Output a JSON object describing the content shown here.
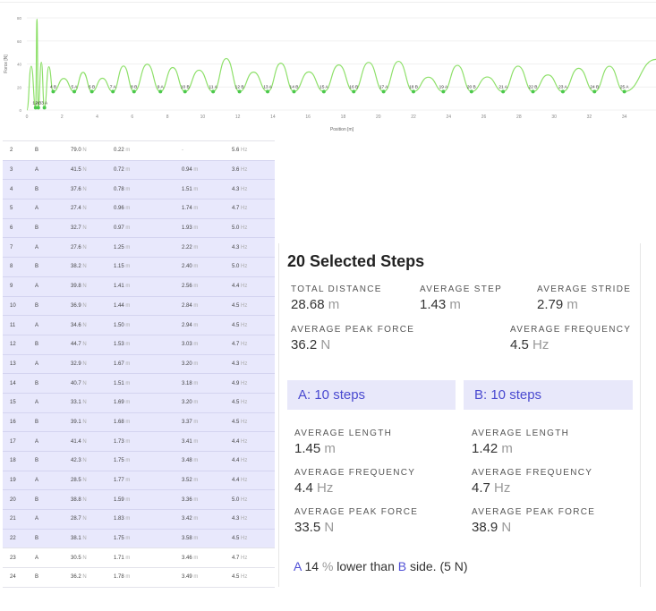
{
  "chart": {
    "y_axis_label": "Force [N]",
    "x_axis_label": "Position [m]",
    "y_ticks": [
      "80",
      "60",
      "40",
      "20",
      "0"
    ],
    "x_ticks": [
      "0",
      "2",
      "4",
      "6",
      "8",
      "10",
      "12",
      "14",
      "16",
      "18",
      "20",
      "22",
      "24",
      "26",
      "28",
      "30",
      "32",
      "34"
    ],
    "line_color": "#8ee06a",
    "marker_color": "#4cc94c",
    "step_markers": [
      {
        "label": "1 A",
        "x": 0.5
      },
      {
        "label": "2 B",
        "x": 0.65
      },
      {
        "label": "3 A",
        "x": 1.0
      },
      {
        "label": "4 B",
        "x": 1.5
      },
      {
        "label": "5 A",
        "x": 2.7
      },
      {
        "label": "6 B",
        "x": 3.7
      },
      {
        "label": "7 A",
        "x": 4.9
      },
      {
        "label": "8 B",
        "x": 6.1
      },
      {
        "label": "9 A",
        "x": 7.6
      },
      {
        "label": "10 B",
        "x": 9.0
      },
      {
        "label": "11 A",
        "x": 10.6
      },
      {
        "label": "12 B",
        "x": 12.1
      },
      {
        "label": "13 A",
        "x": 13.7
      },
      {
        "label": "14 B",
        "x": 15.2
      },
      {
        "label": "15 A",
        "x": 16.9
      },
      {
        "label": "16 B",
        "x": 18.6
      },
      {
        "label": "17 A",
        "x": 20.3
      },
      {
        "label": "18 B",
        "x": 22.0
      },
      {
        "label": "19 A",
        "x": 23.7
      },
      {
        "label": "20 B",
        "x": 25.3
      },
      {
        "label": "21 A",
        "x": 27.1
      },
      {
        "label": "22 B",
        "x": 28.8
      },
      {
        "label": "23 A",
        "x": 30.5
      },
      {
        "label": "24 B",
        "x": 32.3
      },
      {
        "label": "25 A",
        "x": 34.0
      }
    ]
  },
  "table": {
    "rows": [
      {
        "n": "2",
        "side": "B",
        "force": "79.0",
        "force_unit": "N",
        "length": "0.22",
        "length_unit": "m",
        "stride": "-",
        "stride_unit": "",
        "freq": "5.6",
        "freq_unit": "Hz",
        "selected": false
      },
      {
        "n": "3",
        "side": "A",
        "force": "41.5",
        "force_unit": "N",
        "length": "0.72",
        "length_unit": "m",
        "stride": "0.94",
        "stride_unit": "m",
        "freq": "3.6",
        "freq_unit": "Hz",
        "selected": true
      },
      {
        "n": "4",
        "side": "B",
        "force": "37.6",
        "force_unit": "N",
        "length": "0.78",
        "length_unit": "m",
        "stride": "1.51",
        "stride_unit": "m",
        "freq": "4.3",
        "freq_unit": "Hz",
        "selected": true
      },
      {
        "n": "5",
        "side": "A",
        "force": "27.4",
        "force_unit": "N",
        "length": "0.96",
        "length_unit": "m",
        "stride": "1.74",
        "stride_unit": "m",
        "freq": "4.7",
        "freq_unit": "Hz",
        "selected": true
      },
      {
        "n": "6",
        "side": "B",
        "force": "32.7",
        "force_unit": "N",
        "length": "0.97",
        "length_unit": "m",
        "stride": "1.93",
        "stride_unit": "m",
        "freq": "5.0",
        "freq_unit": "Hz",
        "selected": true
      },
      {
        "n": "7",
        "side": "A",
        "force": "27.6",
        "force_unit": "N",
        "length": "1.25",
        "length_unit": "m",
        "stride": "2.22",
        "stride_unit": "m",
        "freq": "4.3",
        "freq_unit": "Hz",
        "selected": true
      },
      {
        "n": "8",
        "side": "B",
        "force": "38.2",
        "force_unit": "N",
        "length": "1.15",
        "length_unit": "m",
        "stride": "2.40",
        "stride_unit": "m",
        "freq": "5.0",
        "freq_unit": "Hz",
        "selected": true
      },
      {
        "n": "9",
        "side": "A",
        "force": "39.8",
        "force_unit": "N",
        "length": "1.41",
        "length_unit": "m",
        "stride": "2.56",
        "stride_unit": "m",
        "freq": "4.4",
        "freq_unit": "Hz",
        "selected": true
      },
      {
        "n": "10",
        "side": "B",
        "force": "36.9",
        "force_unit": "N",
        "length": "1.44",
        "length_unit": "m",
        "stride": "2.84",
        "stride_unit": "m",
        "freq": "4.5",
        "freq_unit": "Hz",
        "selected": true
      },
      {
        "n": "11",
        "side": "A",
        "force": "34.6",
        "force_unit": "N",
        "length": "1.50",
        "length_unit": "m",
        "stride": "2.94",
        "stride_unit": "m",
        "freq": "4.5",
        "freq_unit": "Hz",
        "selected": true
      },
      {
        "n": "12",
        "side": "B",
        "force": "44.7",
        "force_unit": "N",
        "length": "1.53",
        "length_unit": "m",
        "stride": "3.03",
        "stride_unit": "m",
        "freq": "4.7",
        "freq_unit": "Hz",
        "selected": true
      },
      {
        "n": "13",
        "side": "A",
        "force": "32.9",
        "force_unit": "N",
        "length": "1.67",
        "length_unit": "m",
        "stride": "3.20",
        "stride_unit": "m",
        "freq": "4.3",
        "freq_unit": "Hz",
        "selected": true
      },
      {
        "n": "14",
        "side": "B",
        "force": "40.7",
        "force_unit": "N",
        "length": "1.51",
        "length_unit": "m",
        "stride": "3.18",
        "stride_unit": "m",
        "freq": "4.9",
        "freq_unit": "Hz",
        "selected": true
      },
      {
        "n": "15",
        "side": "A",
        "force": "33.1",
        "force_unit": "N",
        "length": "1.69",
        "length_unit": "m",
        "stride": "3.20",
        "stride_unit": "m",
        "freq": "4.5",
        "freq_unit": "Hz",
        "selected": true
      },
      {
        "n": "16",
        "side": "B",
        "force": "39.1",
        "force_unit": "N",
        "length": "1.68",
        "length_unit": "m",
        "stride": "3.37",
        "stride_unit": "m",
        "freq": "4.5",
        "freq_unit": "Hz",
        "selected": true
      },
      {
        "n": "17",
        "side": "A",
        "force": "41.4",
        "force_unit": "N",
        "length": "1.73",
        "length_unit": "m",
        "stride": "3.41",
        "stride_unit": "m",
        "freq": "4.4",
        "freq_unit": "Hz",
        "selected": true
      },
      {
        "n": "18",
        "side": "B",
        "force": "42.3",
        "force_unit": "N",
        "length": "1.75",
        "length_unit": "m",
        "stride": "3.48",
        "stride_unit": "m",
        "freq": "4.4",
        "freq_unit": "Hz",
        "selected": true
      },
      {
        "n": "19",
        "side": "A",
        "force": "28.5",
        "force_unit": "N",
        "length": "1.77",
        "length_unit": "m",
        "stride": "3.52",
        "stride_unit": "m",
        "freq": "4.4",
        "freq_unit": "Hz",
        "selected": true
      },
      {
        "n": "20",
        "side": "B",
        "force": "38.8",
        "force_unit": "N",
        "length": "1.59",
        "length_unit": "m",
        "stride": "3.36",
        "stride_unit": "m",
        "freq": "5.0",
        "freq_unit": "Hz",
        "selected": true
      },
      {
        "n": "21",
        "side": "A",
        "force": "28.7",
        "force_unit": "N",
        "length": "1.83",
        "length_unit": "m",
        "stride": "3.42",
        "stride_unit": "m",
        "freq": "4.3",
        "freq_unit": "Hz",
        "selected": true
      },
      {
        "n": "22",
        "side": "B",
        "force": "38.1",
        "force_unit": "N",
        "length": "1.75",
        "length_unit": "m",
        "stride": "3.58",
        "stride_unit": "m",
        "freq": "4.5",
        "freq_unit": "Hz",
        "selected": true
      },
      {
        "n": "23",
        "side": "A",
        "force": "30.5",
        "force_unit": "N",
        "length": "1.71",
        "length_unit": "m",
        "stride": "3.46",
        "stride_unit": "m",
        "freq": "4.7",
        "freq_unit": "Hz",
        "selected": false
      },
      {
        "n": "24",
        "side": "B",
        "force": "36.2",
        "force_unit": "N",
        "length": "1.78",
        "length_unit": "m",
        "stride": "3.49",
        "stride_unit": "m",
        "freq": "4.5",
        "freq_unit": "Hz",
        "selected": false
      }
    ]
  },
  "summary": {
    "title": "20 Selected Steps",
    "total_distance": {
      "label": "TOTAL DISTANCE",
      "value": "28.68",
      "unit": "m"
    },
    "average_step": {
      "label": "AVERAGE STEP",
      "value": "1.43",
      "unit": "m"
    },
    "average_stride": {
      "label": "AVERAGE STRIDE",
      "value": "2.79",
      "unit": "m"
    },
    "average_peak_force": {
      "label": "AVERAGE PEAK FORCE",
      "value": "36.2",
      "unit": "N"
    },
    "average_frequency": {
      "label": "AVERAGE FREQUENCY",
      "value": "4.5",
      "unit": "Hz"
    },
    "side_a": {
      "header": "A: 10 steps",
      "length": {
        "label": "AVERAGE LENGTH",
        "value": "1.45",
        "unit": "m"
      },
      "frequency": {
        "label": "AVERAGE FREQUENCY",
        "value": "4.4",
        "unit": "Hz"
      },
      "peak_force": {
        "label": "AVERAGE PEAK FORCE",
        "value": "33.5",
        "unit": "N"
      }
    },
    "side_b": {
      "header": "B: 10 steps",
      "length": {
        "label": "AVERAGE LENGTH",
        "value": "1.42",
        "unit": "m"
      },
      "frequency": {
        "label": "AVERAGE FREQUENCY",
        "value": "4.7",
        "unit": "Hz"
      },
      "peak_force": {
        "label": "AVERAGE PEAK FORCE",
        "value": "38.9",
        "unit": "N"
      }
    },
    "comparison": {
      "side_a": "A",
      "number": "14",
      "percent_sign": "%",
      "text_mid": "lower than",
      "side_b": "B",
      "text_end": "side. (5 N)"
    },
    "accent_color": "#4f4fd6"
  }
}
